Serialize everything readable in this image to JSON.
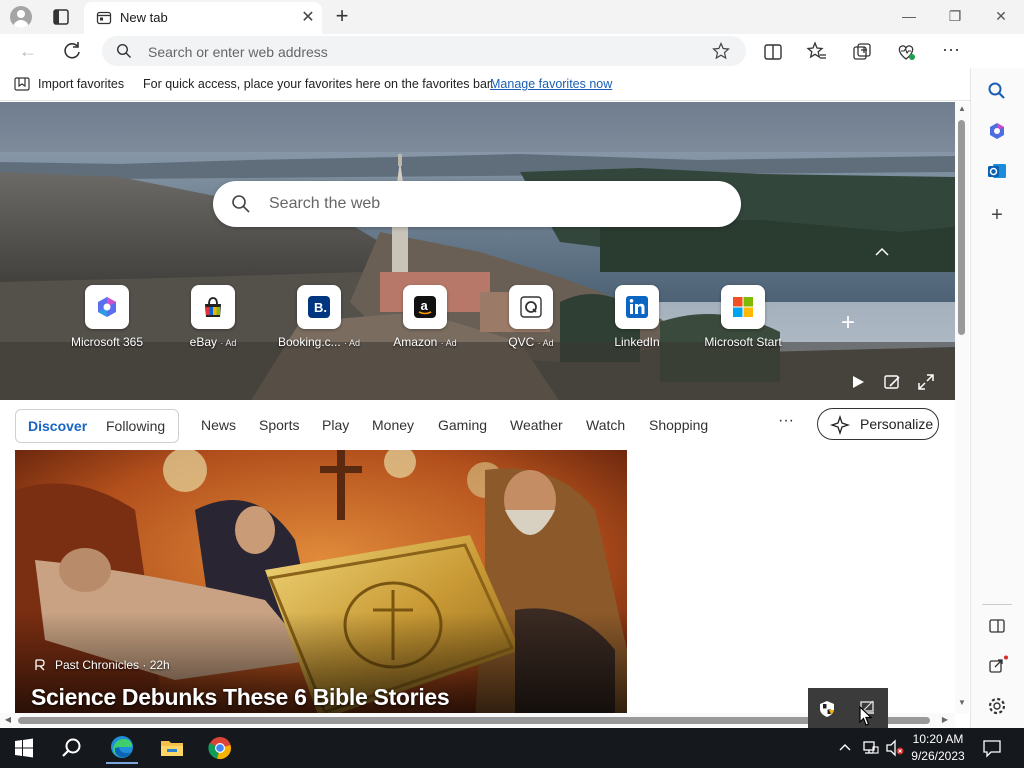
{
  "browser": {
    "tab_title": "New tab",
    "address_placeholder": "Search or enter web address"
  },
  "favorites_bar": {
    "import_label": "Import favorites",
    "hint": "For quick access, place your favorites here on the favorites bar.",
    "manage_link": "Manage favorites now"
  },
  "hero": {
    "search_placeholder": "Search the web",
    "tiles": [
      {
        "label": "Microsoft 365",
        "ad": "",
        "icon": "microsoft-365-icon"
      },
      {
        "label": "eBay",
        "ad": "· Ad",
        "icon": "ebay-icon"
      },
      {
        "label": "Booking.c...",
        "ad": "· Ad",
        "icon": "booking-icon"
      },
      {
        "label": "Amazon",
        "ad": "· Ad",
        "icon": "amazon-icon"
      },
      {
        "label": "QVC",
        "ad": "· Ad",
        "icon": "qvc-icon"
      },
      {
        "label": "LinkedIn",
        "ad": "",
        "icon": "linkedin-icon"
      },
      {
        "label": "Microsoft Start",
        "ad": "",
        "icon": "microsoft-start-icon"
      }
    ]
  },
  "feed": {
    "discover": "Discover",
    "following": "Following",
    "tabs": [
      "News",
      "Sports",
      "Play",
      "Money",
      "Gaming",
      "Weather",
      "Watch",
      "Shopping"
    ],
    "more": "···",
    "personalize": "Personalize"
  },
  "card": {
    "source": "Past Chronicles · 22h",
    "title": "Science Debunks These 6 Bible Stories"
  },
  "taskbar": {
    "time": "10:20 AM",
    "date": "9/26/2023"
  },
  "colors": {
    "accent": "#1766c4",
    "taskbar": "#15181d"
  }
}
